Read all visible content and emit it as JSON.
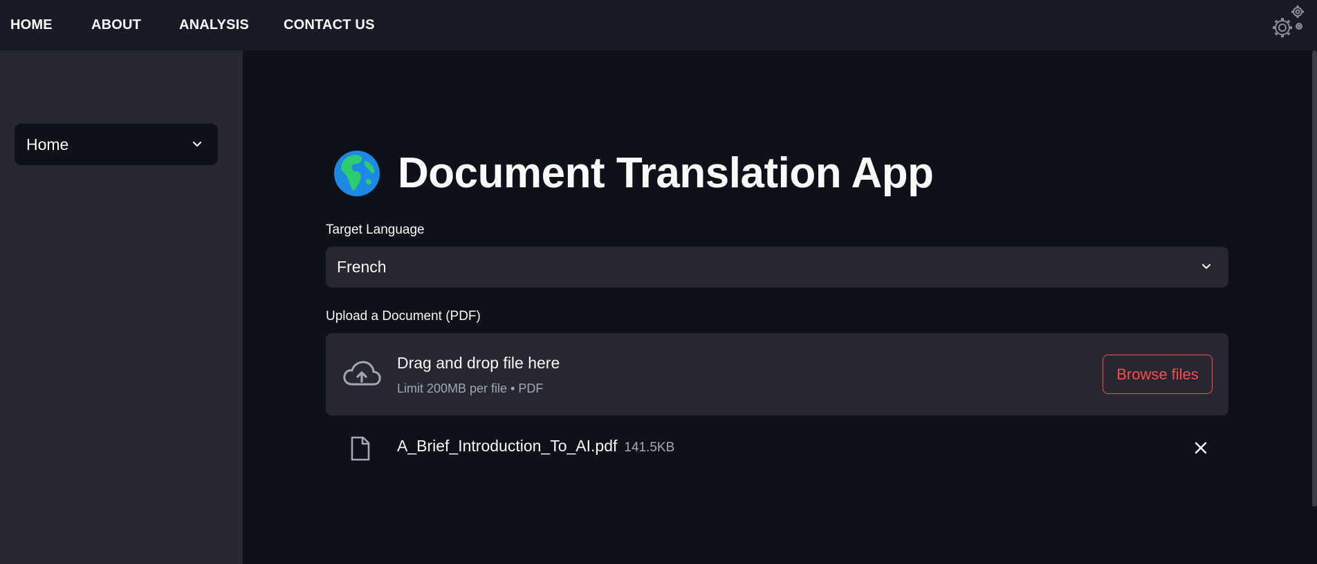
{
  "nav": {
    "items": [
      {
        "label": "HOME"
      },
      {
        "label": "ABOUT"
      },
      {
        "label": "ANALYSIS"
      },
      {
        "label": "CONTACT US"
      }
    ],
    "settings_icon": "gears-icon"
  },
  "sidebar": {
    "select": {
      "value": "Home",
      "icon": "chevron-down-icon"
    }
  },
  "main": {
    "title_icon": "globe-icon",
    "title": "Document Translation App",
    "target_language": {
      "label": "Target Language",
      "value": "French",
      "icon": "chevron-down-icon"
    },
    "upload": {
      "label": "Upload a Document (PDF)",
      "icon": "cloud-upload-icon",
      "dropzone_title": "Drag and drop file here",
      "dropzone_subtitle": "Limit 200MB per file • PDF",
      "browse_label": "Browse files"
    },
    "uploaded_file": {
      "icon": "file-icon",
      "name": "A_Brief_Introduction_To_AI.pdf",
      "size": "141.5KB",
      "remove_icon": "close-icon"
    }
  },
  "colors": {
    "background": "#0e1117",
    "topbar": "#161b26",
    "sidebar": "#262730",
    "accent": "#ff4b4b",
    "muted_text": "#a3a8b8"
  }
}
